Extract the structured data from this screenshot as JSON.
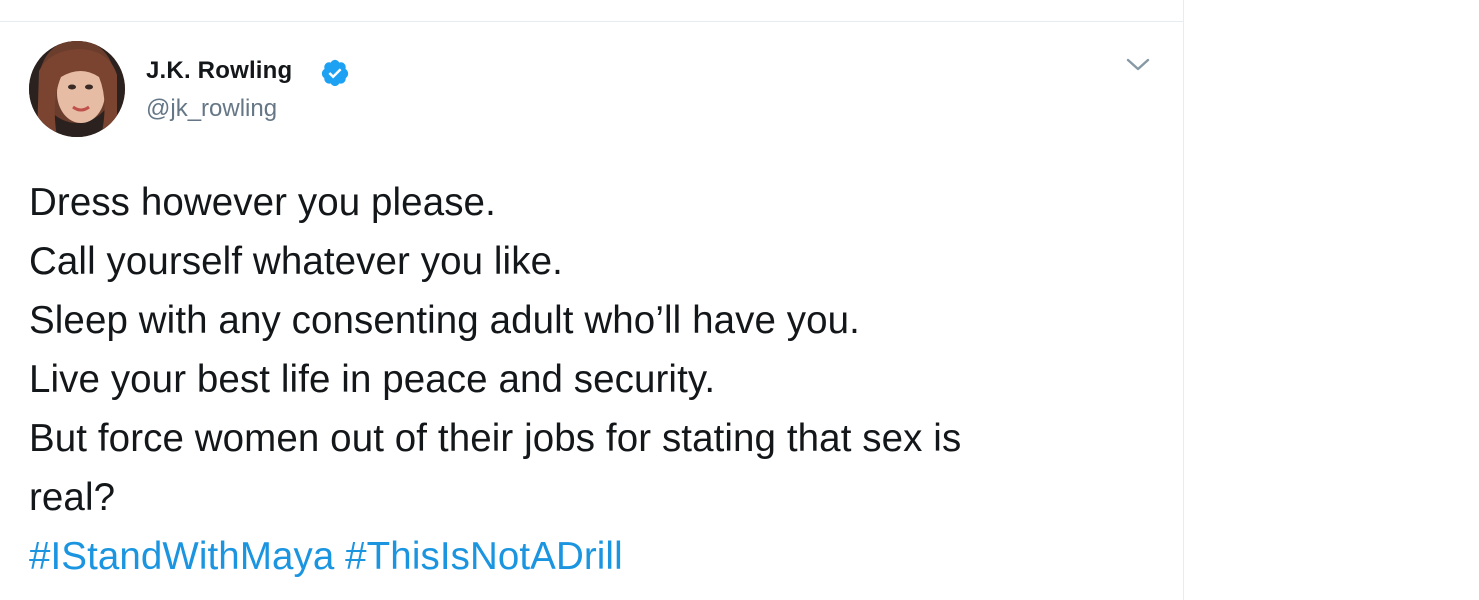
{
  "tweet": {
    "author": {
      "name": "J.K. Rowling",
      "handle": "@jk_rowling",
      "verified": true
    },
    "lines": [
      "Dress however you please.",
      "Call yourself whatever you like.",
      "Sleep with any consenting adult who’ll have you.",
      "Live your best life in peace and security.",
      "But force women out of their jobs for stating that sex is",
      "real?"
    ],
    "hashtags": [
      "#IStandWithMaya",
      "#ThisIsNotADrill"
    ]
  },
  "colors": {
    "text": "#14171a",
    "secondary": "#657786",
    "link": "#1b95e0",
    "verified": "#1da1f2",
    "border": "#e6ecf0"
  },
  "icons": {
    "verified": "verified-badge-icon",
    "menu": "chevron-down-icon"
  }
}
